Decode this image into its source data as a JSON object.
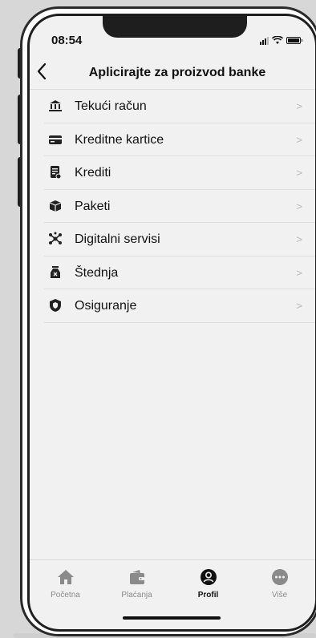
{
  "status_bar": {
    "time": "08:54"
  },
  "header": {
    "back_icon": "chevron-left-icon",
    "title": "Aplicirajte za proizvod banke"
  },
  "menu": {
    "items": [
      {
        "label": "Tekući račun",
        "icon": "bank-icon"
      },
      {
        "label": "Kreditne kartice",
        "icon": "credit-card-icon"
      },
      {
        "label": "Krediti",
        "icon": "loan-document-icon"
      },
      {
        "label": "Paketi",
        "icon": "package-icon"
      },
      {
        "label": "Digitalni servisi",
        "icon": "digital-network-icon"
      },
      {
        "label": "Štednja",
        "icon": "money-bag-icon"
      },
      {
        "label": "Osiguranje",
        "icon": "shield-icon"
      }
    ],
    "chevron": ">"
  },
  "tabbar": {
    "tabs": [
      {
        "label": "Početna",
        "icon": "home-icon",
        "active": false
      },
      {
        "label": "Plaćanja",
        "icon": "wallet-icon",
        "active": false
      },
      {
        "label": "Profil",
        "icon": "user-icon",
        "active": true
      },
      {
        "label": "Više",
        "icon": "more-icon",
        "active": false
      }
    ]
  },
  "colors": {
    "background": "#f1f1f1",
    "text": "#111111",
    "inactive_tab": "#8a8a8a"
  }
}
